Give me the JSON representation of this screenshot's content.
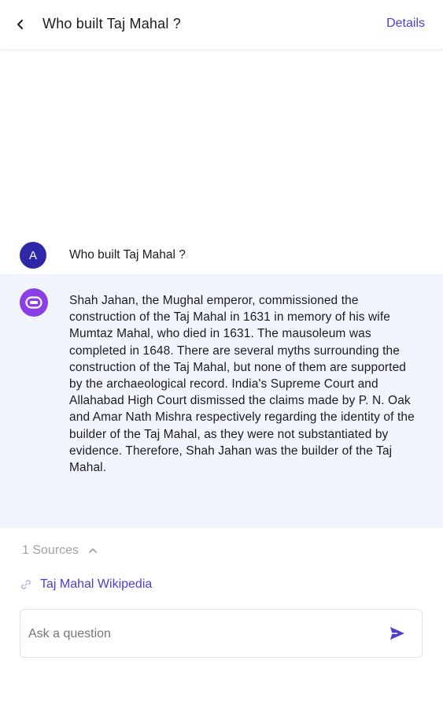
{
  "header": {
    "title": "Who built Taj Mahal ?",
    "details_label": "Details",
    "back_icon": "chevron-left-icon"
  },
  "conversation": {
    "user": {
      "avatar_letter": "A",
      "question": "Who built Taj Mahal ?"
    },
    "assistant": {
      "avatar_icon": "bot-icon",
      "answer": "Shah Jahan, the Mughal emperor, commissioned the construction of the Taj Mahal in 1631 in memory of his wife Mumtaz Mahal, who died in 1631. The mausoleum was completed in 1648. There are several myths surrounding the construction of the Taj Mahal, but none of them are supported by the archaeological record. India's Supreme Court and Allahabad High Court dismissed the claims made by P. N. Oak and Amar Nath Mishra respectively regarding the identity of the builder of the Taj Mahal, as they were not substantiated by evidence. Therefore, Shah Jahan was the builder of the Taj Mahal."
    }
  },
  "sources": {
    "label": "1 Sources",
    "items": [
      {
        "title": "Taj Mahal Wikipedia"
      }
    ]
  },
  "ask": {
    "placeholder": "Ask a question",
    "value": ""
  },
  "colors": {
    "accent": "#4a3fd0",
    "user_avatar": "#2e27a8",
    "bot_avatar": "#8b3fe6",
    "answer_background": "#f2f5fd",
    "muted_text": "#a3a3a3"
  }
}
